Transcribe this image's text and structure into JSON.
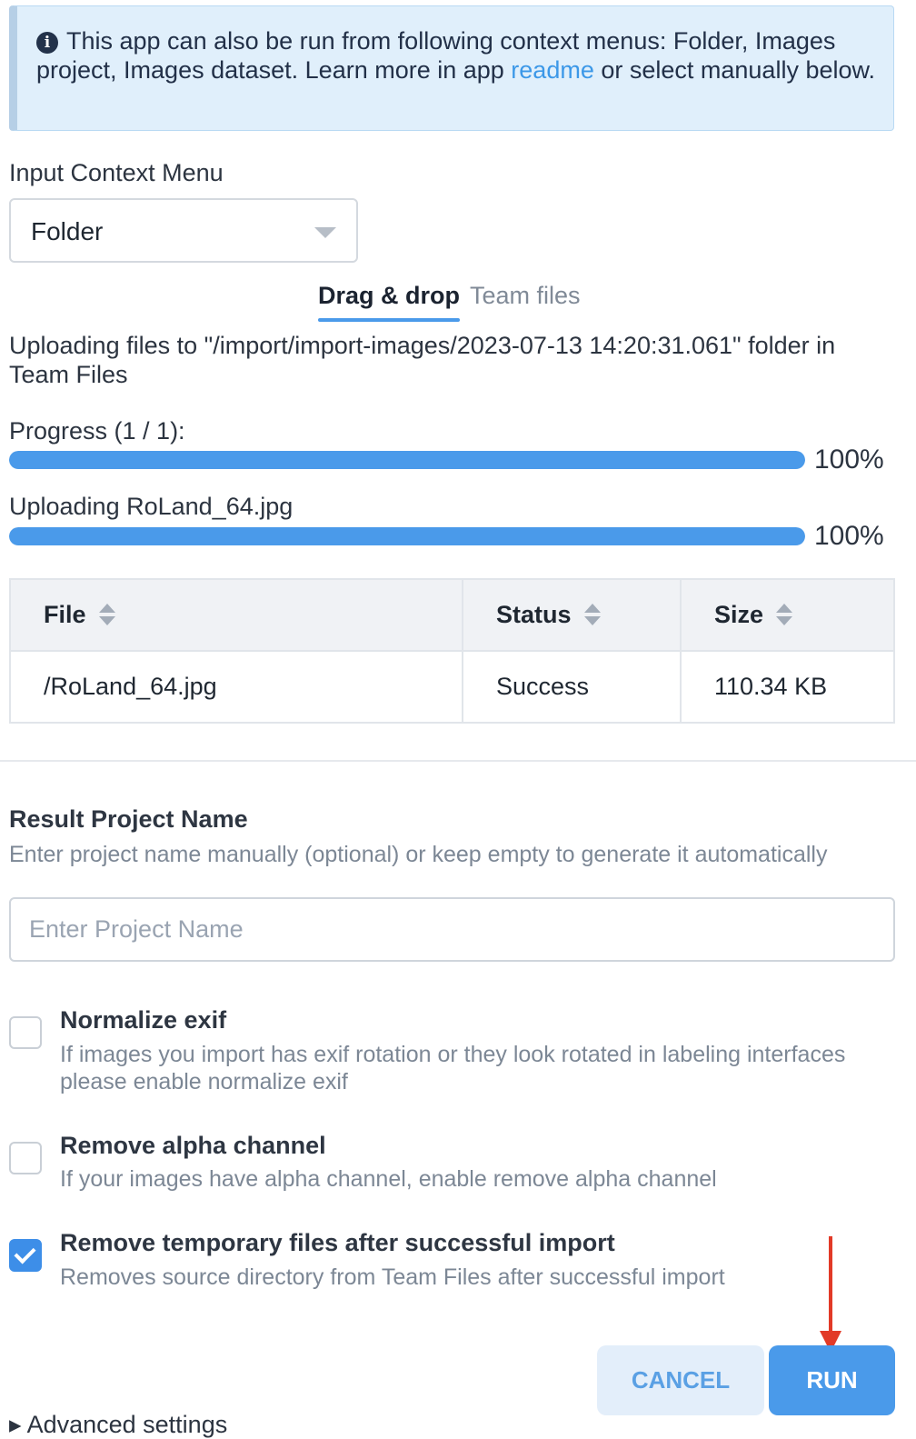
{
  "info": {
    "icon": "info-icon",
    "text_before": "This app can also be run from following context menus: Folder, Images project, Images dataset. Learn more in app ",
    "link": "readme",
    "text_after": " or select manually below."
  },
  "context_menu": {
    "label": "Input Context Menu",
    "selected": "Folder"
  },
  "tabs": [
    {
      "label": "Drag & drop",
      "active": true
    },
    {
      "label": "Team files",
      "active": false
    }
  ],
  "upload": {
    "message": "Uploading files to \"/import/import-images/2023-07-13 14:20:31.061\" folder in Team Files",
    "progress_label": "Progress (1 / 1):",
    "progress_value": 1.0,
    "progress_pct": "100%",
    "file_label": "Uploading RoLand_64.jpg",
    "file_value": 1.0,
    "file_pct": "100%"
  },
  "table": {
    "headers": [
      "File",
      "Status",
      "Size"
    ],
    "rows": [
      [
        "/RoLand_64.jpg",
        "Success",
        "110.34 KB"
      ]
    ]
  },
  "project": {
    "title": "Result Project Name",
    "subtitle": "Enter project name manually (optional) or keep empty to generate it automatically",
    "value": "",
    "placeholder": "Enter Project Name"
  },
  "options": [
    {
      "title": "Normalize exif",
      "desc": "If images you import has exif rotation or they look rotated in labeling interfaces please enable normalize exif",
      "checked": false
    },
    {
      "title": "Remove alpha channel",
      "desc": "If your images have alpha channel, enable remove alpha channel",
      "checked": false
    },
    {
      "title": "Remove temporary files after successful import",
      "desc": "Removes source directory from Team Files after successful import",
      "checked": true
    }
  ],
  "buttons": {
    "cancel": "CANCEL",
    "run": "RUN"
  },
  "advanced": "▸ Advanced settings",
  "colors": {
    "accent": "#4a9aea",
    "info_bg": "#e0effb",
    "annotation_arrow": "#e23a27"
  }
}
